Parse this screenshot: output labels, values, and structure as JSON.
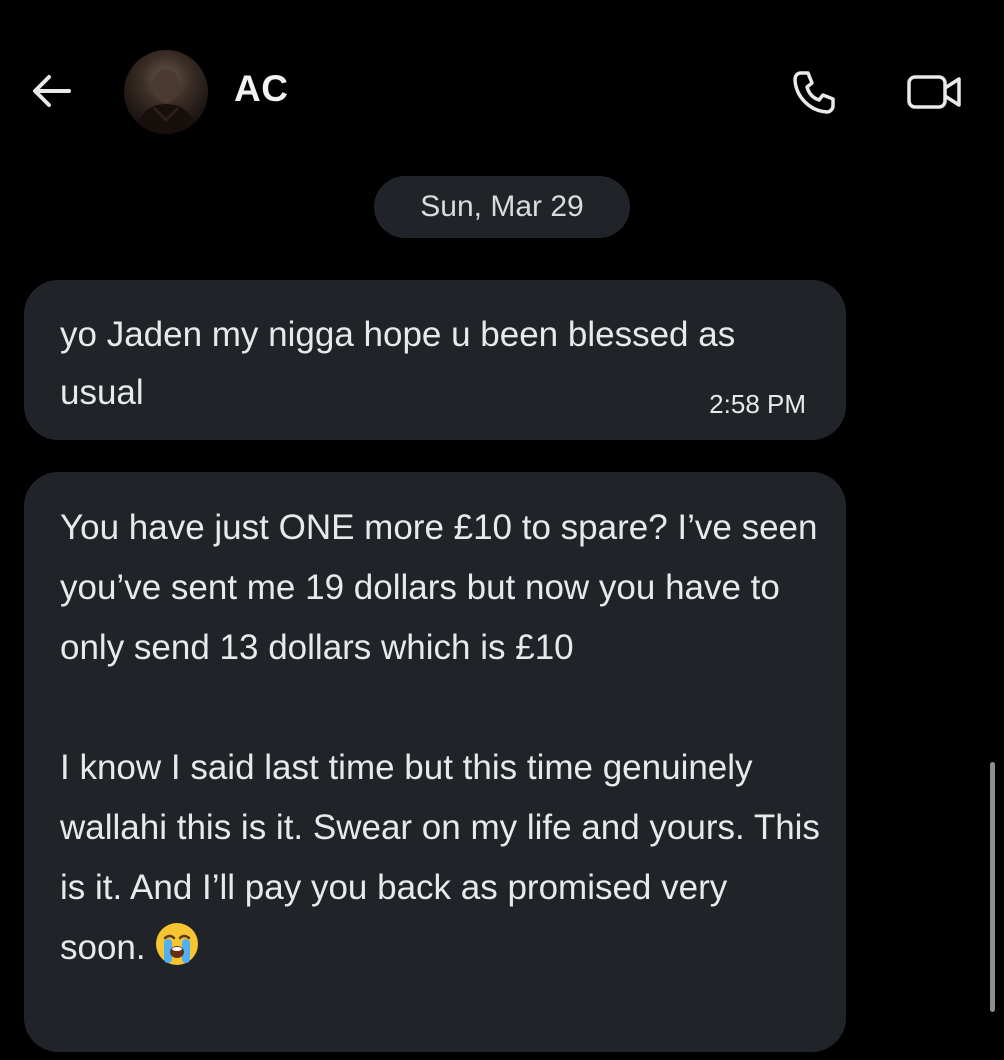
{
  "header": {
    "back_icon": "arrow-left-icon",
    "contact_name": "AC",
    "call_icon": "phone-icon",
    "video_icon": "video-camera-icon"
  },
  "date_separator": "Sun, Mar 29",
  "messages": [
    {
      "text": "yo Jaden my nigga hope u been blessed as usual",
      "time": "2:58 PM"
    },
    {
      "paragraphs": [
        "You have just ONE more £10 to spare? I’ve seen you’ve sent me 19 dollars but now you have to only send 13 dollars which is £10",
        "I know I said last time but this time genuinely wallahi this is it. Swear on my life and yours. This is it. And I’ll pay you back as promised very soon."
      ],
      "emoji": "loudly-crying-face-icon"
    }
  ],
  "colors": {
    "background": "#000000",
    "bubble": "#202327",
    "text": "#e7e9ea"
  }
}
